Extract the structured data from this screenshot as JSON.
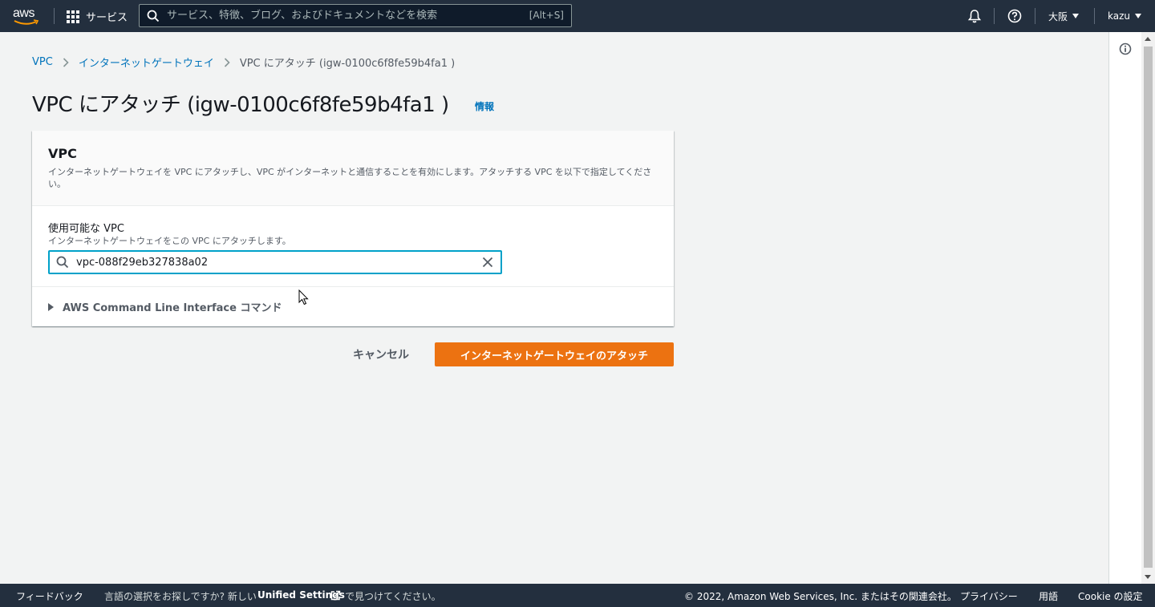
{
  "topnav": {
    "logo_text": "aws",
    "services_label": "サービス",
    "search_placeholder": "サービス、特徴、ブログ、およびドキュメントなどを検索",
    "search_shortcut": "[Alt+S]",
    "region_label": "大阪",
    "user_label": "kazu",
    "icons": [
      "grid-icon",
      "search-icon",
      "bell-icon",
      "help-icon"
    ]
  },
  "breadcrumb": {
    "items": [
      "VPC",
      "インターネットゲートウェイ"
    ],
    "current": "VPC にアタッチ (igw-0100c6f8fe59b4fa1 )"
  },
  "page": {
    "title": "VPC にアタッチ (igw-0100c6f8fe59b4fa1 )",
    "info_link": "情報"
  },
  "container": {
    "header_title": "VPC",
    "header_description": "インターネットゲートウェイを VPC にアタッチし、VPC がインターネットと通信することを有効にします。アタッチする VPC を以下で指定してください。",
    "field_label": "使用可能な VPC",
    "field_description": "インターネットゲートウェイをこの VPC にアタッチします。",
    "field_value": "vpc-088f29eb327838a02",
    "expander_label": "AWS Command Line Interface コマンド"
  },
  "actions": {
    "cancel_label": "キャンセル",
    "primary_label": "インターネットゲートウェイのアタッチ"
  },
  "footer": {
    "feedback": "フィードバック",
    "language_prefix": "言語の選択をお探しですか? 新しい",
    "unified_settings": "Unified Settings",
    "language_suffix": "で見つけてください。",
    "copyright": "© 2022, Amazon Web Services, Inc. またはその関連会社。",
    "privacy": "プライバシー",
    "terms": "用語",
    "cookie": "Cookie の設定"
  },
  "colors": {
    "nav_bg": "#232f3e",
    "primary_button": "#ec7211",
    "link": "#0073bb",
    "focus_border": "#00a1c9",
    "page_bg": "#f2f3f3"
  }
}
